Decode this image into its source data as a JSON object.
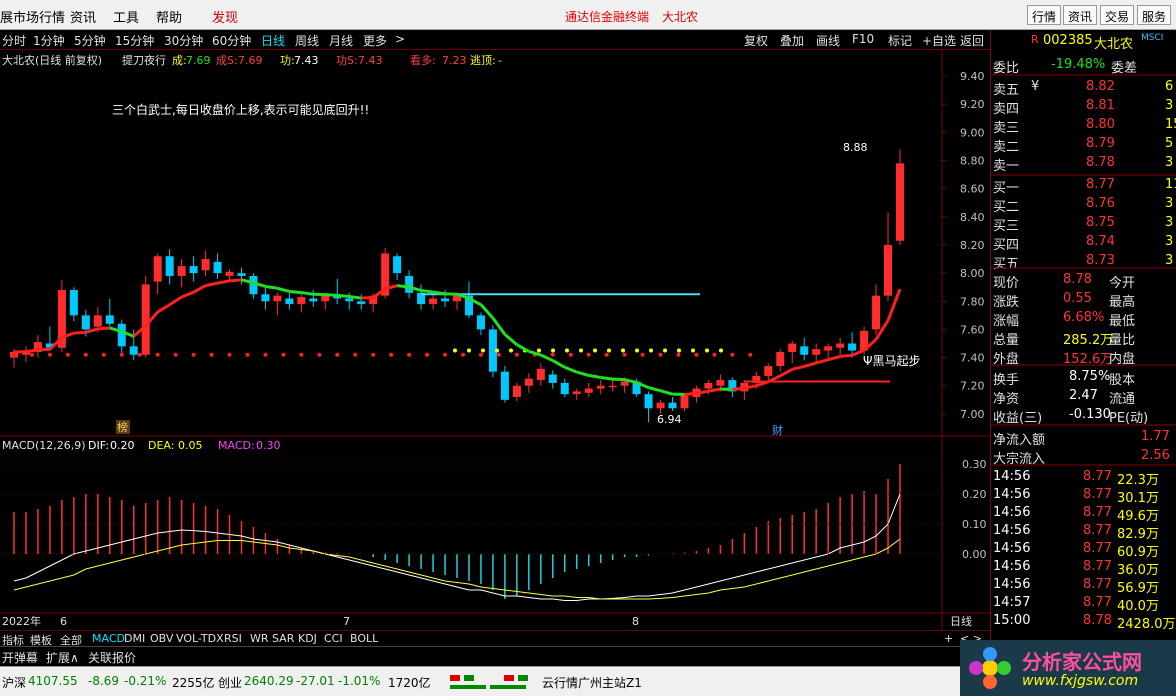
{
  "menu": {
    "market": "展市场行情",
    "news": "资讯",
    "tools": "工具",
    "help": "帮助",
    "discover": "发现",
    "center_title": "通达信金融终端",
    "center_stock": "大北农",
    "right_buttons": [
      "行情",
      "资讯",
      "交易",
      "服务"
    ]
  },
  "period": {
    "items": [
      "分时",
      "1分钟",
      "5分钟",
      "15分钟",
      "30分钟",
      "60分钟",
      "日线",
      "周线",
      "月线",
      "更多"
    ],
    "selected": "日线",
    "arrow": ">",
    "right": [
      "复权",
      "叠加",
      "画线",
      "F10",
      "标记",
      "+自选",
      "返回"
    ]
  },
  "main_header": {
    "name": "大北农(日线 前复权)",
    "indicator": "提刀夜行",
    "cheng_label": "成:",
    "cheng": "7.69",
    "chengS_label": "成S:",
    "chengS": "7.69",
    "gong_label": "功:",
    "gong": "7.43",
    "gongS_label": "功S:",
    "gongS": "7.43",
    "kanduo_label": "看多:",
    "kanduo": "7.23",
    "taoding_label": "逃顶:",
    "taoding": "-"
  },
  "annotation": {
    "text": "三个白武士,每日收盘价上移,表示可能见底回升!!",
    "high_label": "8.88",
    "low_label": "6.94",
    "heima": "Ψ黑马起步",
    "bang": "榜",
    "cai": "财"
  },
  "price_axis": [
    "9.40",
    "9.20",
    "9.00",
    "8.80",
    "8.60",
    "8.40",
    "8.20",
    "8.00",
    "7.80",
    "7.60",
    "7.40",
    "7.20",
    "7.00"
  ],
  "macd_header": {
    "label": "MACD(12,26,9)",
    "dif_label": "DIF:",
    "dif": "0.20",
    "dea_label": "DEA:",
    "dea": "0.05",
    "macd_label": "MACD:",
    "macd": "0.30"
  },
  "macd_axis": [
    "0.30",
    "0.20",
    "0.10",
    "0.00"
  ],
  "date_axis": {
    "year": "2022年",
    "m6": "6",
    "m7": "7",
    "m8": "8",
    "period_label": "日线"
  },
  "chart_data": {
    "type": "candlestick",
    "price_ylim": [
      6.85,
      9.5
    ],
    "macd_ylim": [
      -0.17,
      0.33
    ],
    "candles": [
      {
        "o": 7.4,
        "h": 7.46,
        "l": 7.33,
        "c": 7.44
      },
      {
        "o": 7.42,
        "h": 7.48,
        "l": 7.37,
        "c": 7.45
      },
      {
        "o": 7.44,
        "h": 7.56,
        "l": 7.4,
        "c": 7.51
      },
      {
        "o": 7.5,
        "h": 7.62,
        "l": 7.45,
        "c": 7.47
      },
      {
        "o": 7.47,
        "h": 7.95,
        "l": 7.44,
        "c": 7.88
      },
      {
        "o": 7.88,
        "h": 7.9,
        "l": 7.66,
        "c": 7.7
      },
      {
        "o": 7.7,
        "h": 7.74,
        "l": 7.55,
        "c": 7.6
      },
      {
        "o": 7.62,
        "h": 7.76,
        "l": 7.58,
        "c": 7.7
      },
      {
        "o": 7.7,
        "h": 7.82,
        "l": 7.62,
        "c": 7.64
      },
      {
        "o": 7.64,
        "h": 7.67,
        "l": 7.43,
        "c": 7.48
      },
      {
        "o": 7.48,
        "h": 7.6,
        "l": 7.38,
        "c": 7.42
      },
      {
        "o": 7.42,
        "h": 7.98,
        "l": 7.4,
        "c": 7.92
      },
      {
        "o": 7.94,
        "h": 8.14,
        "l": 7.85,
        "c": 8.12
      },
      {
        "o": 8.12,
        "h": 8.17,
        "l": 7.92,
        "c": 7.98
      },
      {
        "o": 7.98,
        "h": 8.1,
        "l": 7.9,
        "c": 8.05
      },
      {
        "o": 8.05,
        "h": 8.12,
        "l": 7.94,
        "c": 8.0
      },
      {
        "o": 8.02,
        "h": 8.16,
        "l": 7.98,
        "c": 8.1
      },
      {
        "o": 8.08,
        "h": 8.14,
        "l": 7.96,
        "c": 8.0
      },
      {
        "o": 7.98,
        "h": 8.03,
        "l": 7.94,
        "c": 8.01
      },
      {
        "o": 8.0,
        "h": 8.04,
        "l": 7.92,
        "c": 7.98
      },
      {
        "o": 7.98,
        "h": 8.0,
        "l": 7.82,
        "c": 7.85
      },
      {
        "o": 7.85,
        "h": 7.9,
        "l": 7.74,
        "c": 7.8
      },
      {
        "o": 7.8,
        "h": 7.86,
        "l": 7.7,
        "c": 7.84
      },
      {
        "o": 7.82,
        "h": 7.86,
        "l": 7.74,
        "c": 7.78
      },
      {
        "o": 7.78,
        "h": 7.85,
        "l": 7.72,
        "c": 7.83
      },
      {
        "o": 7.82,
        "h": 7.88,
        "l": 7.76,
        "c": 7.8
      },
      {
        "o": 7.8,
        "h": 7.86,
        "l": 7.74,
        "c": 7.84
      },
      {
        "o": 7.84,
        "h": 7.96,
        "l": 7.78,
        "c": 7.82
      },
      {
        "o": 7.82,
        "h": 7.86,
        "l": 7.74,
        "c": 7.8
      },
      {
        "o": 7.8,
        "h": 7.85,
        "l": 7.74,
        "c": 7.78
      },
      {
        "o": 7.78,
        "h": 7.86,
        "l": 7.72,
        "c": 7.84
      },
      {
        "o": 7.84,
        "h": 8.18,
        "l": 7.82,
        "c": 8.14
      },
      {
        "o": 8.12,
        "h": 8.14,
        "l": 7.95,
        "c": 8.0
      },
      {
        "o": 7.98,
        "h": 8.02,
        "l": 7.82,
        "c": 7.86
      },
      {
        "o": 7.86,
        "h": 7.92,
        "l": 7.74,
        "c": 7.78
      },
      {
        "o": 7.78,
        "h": 7.86,
        "l": 7.74,
        "c": 7.82
      },
      {
        "o": 7.82,
        "h": 7.88,
        "l": 7.76,
        "c": 7.8
      },
      {
        "o": 7.8,
        "h": 7.86,
        "l": 7.74,
        "c": 7.84
      },
      {
        "o": 7.84,
        "h": 7.94,
        "l": 7.68,
        "c": 7.7
      },
      {
        "o": 7.7,
        "h": 7.72,
        "l": 7.56,
        "c": 7.6
      },
      {
        "o": 7.6,
        "h": 7.63,
        "l": 7.26,
        "c": 7.3
      },
      {
        "o": 7.3,
        "h": 7.34,
        "l": 7.08,
        "c": 7.1
      },
      {
        "o": 7.12,
        "h": 7.22,
        "l": 7.09,
        "c": 7.2
      },
      {
        "o": 7.2,
        "h": 7.29,
        "l": 7.15,
        "c": 7.25
      },
      {
        "o": 7.24,
        "h": 7.36,
        "l": 7.2,
        "c": 7.32
      },
      {
        "o": 7.28,
        "h": 7.31,
        "l": 7.18,
        "c": 7.22
      },
      {
        "o": 7.22,
        "h": 7.25,
        "l": 7.12,
        "c": 7.14
      },
      {
        "o": 7.14,
        "h": 7.18,
        "l": 7.1,
        "c": 7.16
      },
      {
        "o": 7.15,
        "h": 7.22,
        "l": 7.12,
        "c": 7.18
      },
      {
        "o": 7.18,
        "h": 7.24,
        "l": 7.14,
        "c": 7.2
      },
      {
        "o": 7.2,
        "h": 7.26,
        "l": 7.16,
        "c": 7.2
      },
      {
        "o": 7.2,
        "h": 7.26,
        "l": 7.15,
        "c": 7.23
      },
      {
        "o": 7.23,
        "h": 7.25,
        "l": 7.12,
        "c": 7.14
      },
      {
        "o": 7.14,
        "h": 7.16,
        "l": 6.94,
        "c": 7.04
      },
      {
        "o": 7.04,
        "h": 7.1,
        "l": 7.0,
        "c": 7.08
      },
      {
        "o": 7.08,
        "h": 7.12,
        "l": 7.02,
        "c": 7.04
      },
      {
        "o": 7.04,
        "h": 7.15,
        "l": 7.02,
        "c": 7.13
      },
      {
        "o": 7.12,
        "h": 7.2,
        "l": 7.08,
        "c": 7.18
      },
      {
        "o": 7.18,
        "h": 7.24,
        "l": 7.14,
        "c": 7.22
      },
      {
        "o": 7.2,
        "h": 7.28,
        "l": 7.16,
        "c": 7.24
      },
      {
        "o": 7.24,
        "h": 7.26,
        "l": 7.12,
        "c": 7.16
      },
      {
        "o": 7.16,
        "h": 7.24,
        "l": 7.1,
        "c": 7.22
      },
      {
        "o": 7.22,
        "h": 7.3,
        "l": 7.18,
        "c": 7.27
      },
      {
        "o": 7.27,
        "h": 7.36,
        "l": 7.24,
        "c": 7.34
      },
      {
        "o": 7.34,
        "h": 7.46,
        "l": 7.3,
        "c": 7.44
      },
      {
        "o": 7.44,
        "h": 7.52,
        "l": 7.36,
        "c": 7.5
      },
      {
        "o": 7.48,
        "h": 7.54,
        "l": 7.38,
        "c": 7.42
      },
      {
        "o": 7.42,
        "h": 7.5,
        "l": 7.36,
        "c": 7.46
      },
      {
        "o": 7.45,
        "h": 7.5,
        "l": 7.38,
        "c": 7.48
      },
      {
        "o": 7.47,
        "h": 7.54,
        "l": 7.42,
        "c": 7.5
      },
      {
        "o": 7.5,
        "h": 7.58,
        "l": 7.4,
        "c": 7.45
      },
      {
        "o": 7.45,
        "h": 7.62,
        "l": 7.42,
        "c": 7.59
      },
      {
        "o": 7.6,
        "h": 7.92,
        "l": 7.56,
        "c": 7.84
      },
      {
        "o": 7.84,
        "h": 8.43,
        "l": 7.8,
        "c": 8.2
      },
      {
        "o": 8.23,
        "h": 8.88,
        "l": 8.2,
        "c": 8.78
      }
    ],
    "macd_hist": [
      0.14,
      0.14,
      0.15,
      0.16,
      0.18,
      0.19,
      0.2,
      0.2,
      0.19,
      0.18,
      0.16,
      0.17,
      0.18,
      0.19,
      0.18,
      0.17,
      0.16,
      0.15,
      0.13,
      0.11,
      0.09,
      0.07,
      0.05,
      0.03,
      0.02,
      0.01,
      0.005,
      0.003,
      0.002,
      0.001,
      -0.01,
      -0.02,
      -0.03,
      -0.04,
      -0.05,
      -0.06,
      -0.07,
      -0.08,
      -0.09,
      -0.1,
      -0.12,
      -0.15,
      -0.14,
      -0.12,
      -0.1,
      -0.08,
      -0.06,
      -0.05,
      -0.04,
      -0.03,
      -0.02,
      -0.01,
      -0.01,
      -0.005,
      0.0,
      0.003,
      0.005,
      0.01,
      0.02,
      0.03,
      0.05,
      0.07,
      0.09,
      0.11,
      0.12,
      0.13,
      0.14,
      0.15,
      0.17,
      0.19,
      0.2,
      0.21,
      0.2,
      0.25,
      0.3
    ],
    "dif": [
      -0.09,
      -0.08,
      -0.06,
      -0.04,
      -0.02,
      0.0,
      0.01,
      0.02,
      0.03,
      0.04,
      0.05,
      0.06,
      0.07,
      0.075,
      0.08,
      0.078,
      0.075,
      0.07,
      0.065,
      0.06,
      0.05,
      0.045,
      0.04,
      0.03,
      0.02,
      0.01,
      0.0,
      -0.01,
      -0.02,
      -0.03,
      -0.04,
      -0.05,
      -0.06,
      -0.07,
      -0.08,
      -0.09,
      -0.1,
      -0.11,
      -0.12,
      -0.12,
      -0.13,
      -0.14,
      -0.14,
      -0.145,
      -0.15,
      -0.15,
      -0.155,
      -0.155,
      -0.15,
      -0.15,
      -0.148,
      -0.145,
      -0.14,
      -0.14,
      -0.135,
      -0.13,
      -0.12,
      -0.11,
      -0.1,
      -0.09,
      -0.08,
      -0.07,
      -0.06,
      -0.05,
      -0.04,
      -0.03,
      -0.02,
      -0.01,
      0.0,
      0.02,
      0.03,
      0.04,
      0.06,
      0.1,
      0.2
    ],
    "dea": [
      -0.12,
      -0.11,
      -0.1,
      -0.09,
      -0.08,
      -0.07,
      -0.05,
      -0.04,
      -0.03,
      -0.02,
      -0.01,
      0.0,
      0.01,
      0.02,
      0.03,
      0.035,
      0.04,
      0.045,
      0.045,
      0.045,
      0.04,
      0.035,
      0.03,
      0.02,
      0.015,
      0.01,
      0.0,
      -0.005,
      -0.01,
      -0.02,
      -0.03,
      -0.04,
      -0.05,
      -0.06,
      -0.07,
      -0.08,
      -0.09,
      -0.095,
      -0.1,
      -0.11,
      -0.115,
      -0.12,
      -0.125,
      -0.13,
      -0.135,
      -0.14,
      -0.14,
      -0.145,
      -0.145,
      -0.15,
      -0.15,
      -0.15,
      -0.15,
      -0.15,
      -0.148,
      -0.145,
      -0.14,
      -0.135,
      -0.13,
      -0.12,
      -0.115,
      -0.11,
      -0.1,
      -0.09,
      -0.08,
      -0.07,
      -0.06,
      -0.05,
      -0.04,
      -0.03,
      -0.02,
      -0.01,
      0.0,
      0.02,
      0.05
    ]
  },
  "quote": {
    "code_marker": "R",
    "code": "002385",
    "name": "大北农",
    "tag": "MSCI",
    "weibi_label": "委比",
    "weibi": "-19.48%",
    "weicha_label": "委差",
    "asks": [
      {
        "label": "卖五",
        "sym": "¥",
        "price": "8.82",
        "vol": "6"
      },
      {
        "label": "卖四",
        "sym": "",
        "price": "8.81",
        "vol": "3"
      },
      {
        "label": "卖三",
        "sym": "",
        "price": "8.80",
        "vol": "15"
      },
      {
        "label": "卖二",
        "sym": "",
        "price": "8.79",
        "vol": "5"
      },
      {
        "label": "卖一",
        "sym": "",
        "price": "8.78",
        "vol": "3"
      }
    ],
    "bids": [
      {
        "label": "买一",
        "price": "8.77",
        "vol": "11"
      },
      {
        "label": "买二",
        "price": "8.76",
        "vol": "3"
      },
      {
        "label": "买三",
        "price": "8.75",
        "vol": "3"
      },
      {
        "label": "买四",
        "price": "8.74",
        "vol": "3"
      },
      {
        "label": "买五",
        "price": "8.73",
        "vol": "3"
      }
    ],
    "stats": [
      {
        "l1": "现价",
        "v1": "8.78",
        "l2": "今开",
        "c": "#ff3333"
      },
      {
        "l1": "涨跌",
        "v1": "0.55",
        "l2": "最高",
        "c": "#ff3333"
      },
      {
        "l1": "涨幅",
        "v1": "6.68%",
        "l2": "最低",
        "c": "#ff3333"
      },
      {
        "l1": "总量",
        "v1": "285.2万",
        "l2": "量比",
        "c": "#ffff00"
      },
      {
        "l1": "外盘",
        "v1": "152.6万",
        "l2": "内盘",
        "c": "#ff3333"
      }
    ],
    "stats2": [
      {
        "l1": "换手",
        "v1": "8.75%",
        "l2": "股本"
      },
      {
        "l1": "净资",
        "v1": "2.47",
        "l2": "流通"
      },
      {
        "l1": "收益(三)",
        "v1": "-0.130",
        "l2": "PE(动)"
      }
    ],
    "flow": [
      {
        "l": "净流入额",
        "v": "1.77"
      },
      {
        "l": "大宗流入",
        "v": "2.56"
      }
    ],
    "ticks": [
      {
        "t": "14:56",
        "p": "8.77",
        "v": "22.3万"
      },
      {
        "t": "14:56",
        "p": "8.77",
        "v": "30.1万"
      },
      {
        "t": "14:56",
        "p": "8.77",
        "v": "49.6万"
      },
      {
        "t": "14:56",
        "p": "8.77",
        "v": "82.9万"
      },
      {
        "t": "14:56",
        "p": "8.77",
        "v": "60.9万"
      },
      {
        "t": "14:56",
        "p": "8.77",
        "v": "36.0万"
      },
      {
        "t": "14:56",
        "p": "8.77",
        "v": "56.9万"
      },
      {
        "t": "14:57",
        "p": "8.77",
        "v": "40.0万"
      },
      {
        "t": "15:00",
        "p": "8.78",
        "v": "2428.0万"
      }
    ]
  },
  "tabs": {
    "items": [
      "指标",
      "模板",
      "全部",
      "MACD",
      "DMI",
      "OBV",
      "VOL-TDX",
      "RSI",
      "WR",
      "SAR",
      "KDJ",
      "CCI",
      "BOLL"
    ],
    "selected": "MACD",
    "plus": "+",
    "ctrl": "< >"
  },
  "row2": {
    "a": "开弹幕",
    "b": "扩展∧",
    "c": "关联报价"
  },
  "status": {
    "hs_label": "沪深",
    "hs": "4107.55",
    "hs_chg": "-8.69",
    "hs_pct": "-0.21%",
    "hs_amt": "2255亿",
    "cy_label": "创业",
    "cy": "2640.29",
    "cy_chg": "-27.01",
    "cy_pct": "-1.01%",
    "cy_amt": "1720亿",
    "server": "云行情广州主站Z1"
  },
  "watermark": {
    "title": "分析家公式网",
    "url": "www.fxjgsw.com"
  },
  "colors": {
    "up": "#ff2d2d",
    "down": "#00c8ff",
    "ma_red": "#ff2020",
    "ma_green": "#20e020",
    "cyan_line": "#40e0f0",
    "yellow_dot": "#ffff00",
    "grid": "#800000"
  }
}
